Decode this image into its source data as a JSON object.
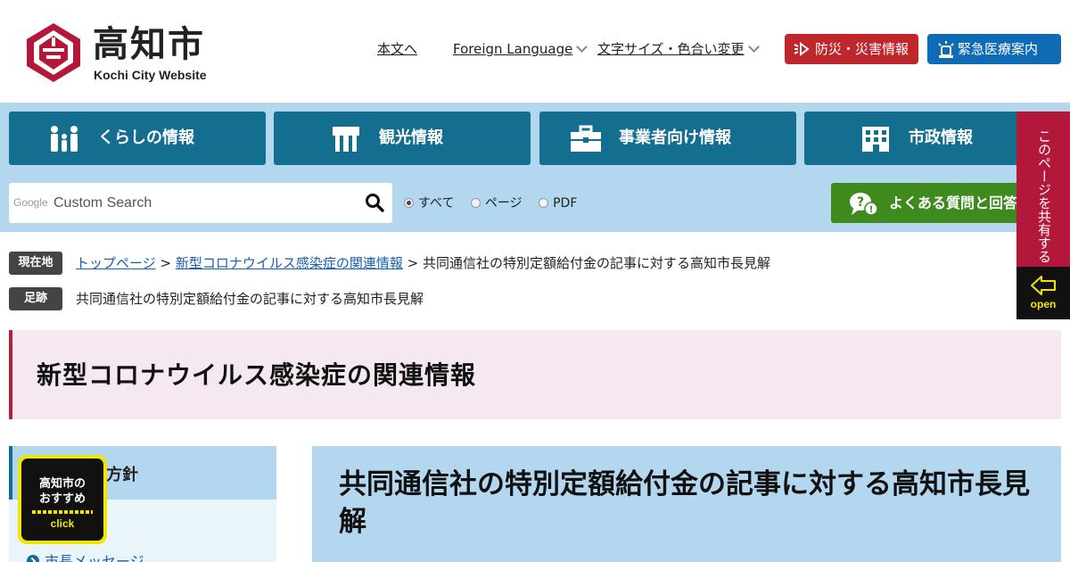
{
  "header": {
    "logo_text": "高知市",
    "logo_subtext": "Kochi City Website",
    "nav_skip": "本文へ",
    "nav_language": "Foreign Language",
    "nav_textsize": "文字サイズ・色合い変更",
    "btn_disaster": "防災・災害情報",
    "btn_medical": "緊急医療案内"
  },
  "global_nav": [
    {
      "label": "くらしの情報",
      "icon": "family-icon"
    },
    {
      "label": "観光情報",
      "icon": "dining-icon"
    },
    {
      "label": "事業者向け情報",
      "icon": "briefcase-icon"
    },
    {
      "label": "市政情報",
      "icon": "building-icon"
    }
  ],
  "search": {
    "google_label": "Google",
    "placeholder": "Custom Search",
    "scope_options": [
      "すべて",
      "ページ",
      "PDF"
    ],
    "scope_selected": "すべて"
  },
  "faq_button": "よくある質問と回答",
  "breadcrumb": {
    "current_label": "現在地",
    "links": [
      "トップページ",
      "新型コロナウイルス感染症の関連情報"
    ],
    "separator": ">",
    "current": "共同通信社の特別定額給付金の記事に対する高知市長見解"
  },
  "history": {
    "label": "足跡",
    "item": "共同通信社の特別定額給付金の記事に対する高知市長見解"
  },
  "section_title": "新型コロナウイルス感染症の関連情報",
  "sidebar": {
    "heading": "方針",
    "links": [
      "方針",
      "市長メッセージ"
    ]
  },
  "article_title": "共同通信社の特別定額給付金の記事に対する高知市長見解",
  "recommend_badge": {
    "line1": "高知市の",
    "line2": "おすすめ",
    "click": "click"
  },
  "side_tab": {
    "text": "このページを共有する",
    "open": "open"
  },
  "colors": {
    "nav_blue": "#136e8f",
    "band_blue": "#b3d7ee",
    "disaster_red": "#c0272d",
    "medical_blue": "#0f6bb5",
    "faq_green": "#3f8a1f",
    "brand_crimson": "#b3183a"
  }
}
